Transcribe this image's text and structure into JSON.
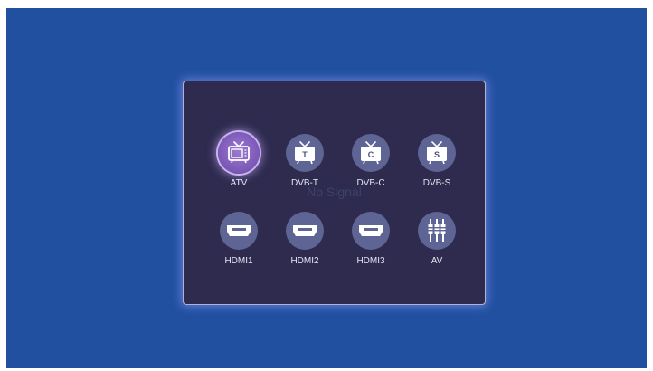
{
  "background_text": "No Signal",
  "colors": {
    "screen_bg": "#2250a0",
    "panel_bg": "#2e2b4f",
    "icon_bg": "#5e6494",
    "selected_bg": "#7a56b6"
  },
  "sources": [
    {
      "label": "ATV",
      "icon": "tv-icon",
      "letter": "",
      "selected": true
    },
    {
      "label": "DVB-T",
      "icon": "tv-icon",
      "letter": "T",
      "selected": false
    },
    {
      "label": "DVB-C",
      "icon": "tv-icon",
      "letter": "C",
      "selected": false
    },
    {
      "label": "DVB-S",
      "icon": "tv-icon",
      "letter": "S",
      "selected": false
    },
    {
      "label": "HDMI1",
      "icon": "hdmi-icon",
      "letter": "",
      "selected": false
    },
    {
      "label": "HDMI2",
      "icon": "hdmi-icon",
      "letter": "",
      "selected": false
    },
    {
      "label": "HDMI3",
      "icon": "hdmi-icon",
      "letter": "",
      "selected": false
    },
    {
      "label": "AV",
      "icon": "av-connector-icon",
      "letter": "",
      "selected": false
    }
  ]
}
